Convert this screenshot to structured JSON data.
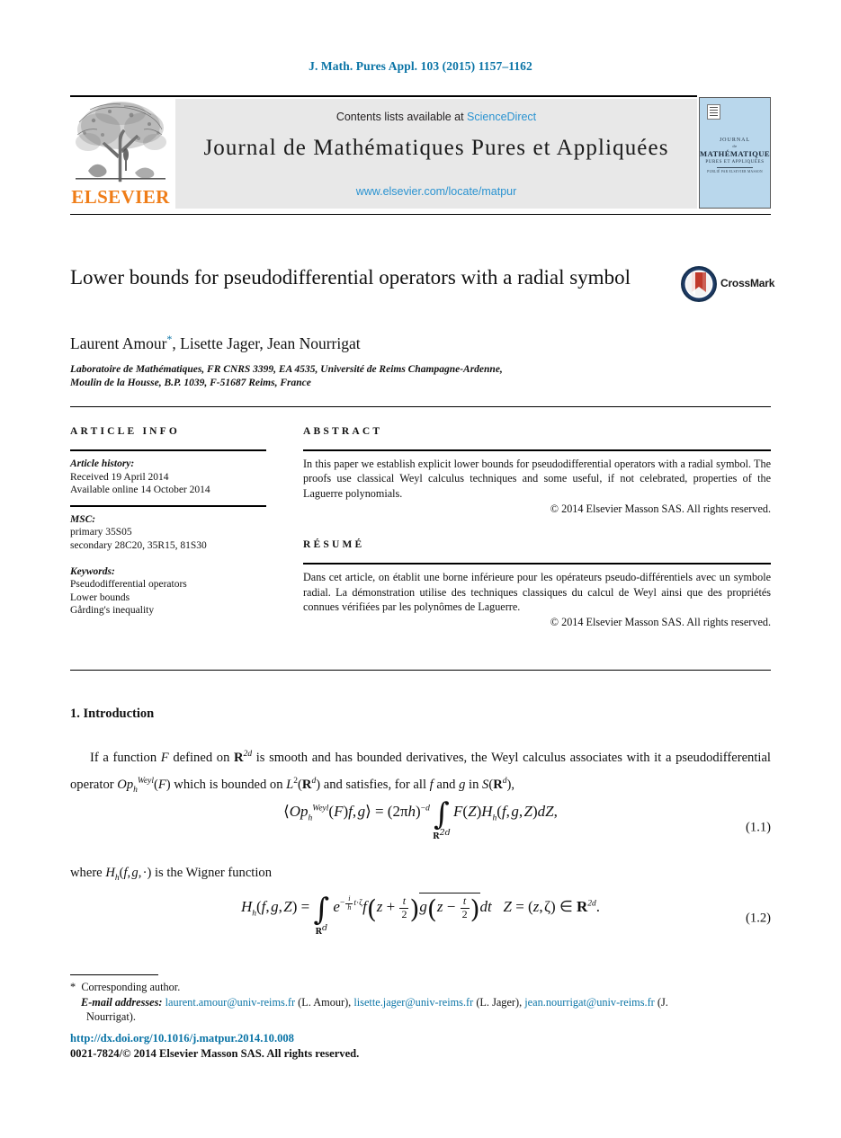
{
  "running_head": "J. Math. Pures Appl. 103 (2015) 1157–1162",
  "masthead": {
    "contents_prefix": "Contents lists available at ",
    "sciencedirect": "ScienceDirect",
    "journal_title": "Journal de Mathématiques Pures et Appliquées",
    "journal_url": "www.elsevier.com/locate/matpur",
    "publisher": "ELSEVIER",
    "cover": {
      "line1": "JOURNAL",
      "line2": "de",
      "line3": "MATHÉMATIQUES",
      "line4": "PURES ET APPLIQUÉES",
      "line5": "PUBLIÉ PAR ELSEVIER MASSON"
    }
  },
  "article": {
    "title": "Lower bounds for pseudodifferential operators with a radial symbol",
    "crossmark_label": "CrossMark",
    "authors": "Laurent Amour, Lisette Jager, Jean Nourrigat",
    "author_star": "*",
    "affiliation_line1": "Laboratoire de Mathématiques, FR CNRS 3399, EA 4535, Université de Reims Champagne-Ardenne,",
    "affiliation_line2": "Moulin de la Housse, B.P. 1039, F-51687 Reims, France"
  },
  "info": {
    "heading": "ARTICLE INFO",
    "history_label": "Article history:",
    "received": "Received 19 April 2014",
    "available": "Available online 14 October 2014",
    "msc_label": "MSC:",
    "msc_primary": "primary 35S05",
    "msc_secondary": "secondary 28C20, 35R15, 81S30",
    "keywords_label": "Keywords:",
    "keyword1": "Pseudodifferential operators",
    "keyword2": "Lower bounds",
    "keyword3": "Gårding's inequality"
  },
  "abstract": {
    "heading": "ABSTRACT",
    "text": "In this paper we establish explicit lower bounds for pseudodifferential operators with a radial symbol. The proofs use classical Weyl calculus techniques and some useful, if not celebrated, properties of the Laguerre polynomials.",
    "copyright": "© 2014 Elsevier Masson SAS. All rights reserved."
  },
  "resume": {
    "heading": "RÉSUMÉ",
    "text": "Dans cet article, on établit une borne inférieure pour les opérateurs pseudo-différentiels avec un symbole radial. La démonstration utilise des techniques classiques du calcul de Weyl ainsi que des propriétés connues vérifiées par les polynômes de Laguerre.",
    "copyright": "© 2014 Elsevier Masson SAS. All rights reserved."
  },
  "body": {
    "section_heading": "1. Introduction",
    "paragraph1_part1": "If a function ",
    "paragraph1": "If a function F defined on R2d is smooth and has bounded derivatives, the Weyl calculus associates with it a pseudodifferential operator OphWeyl(F) which is bounded on L2(Rd) and satisfies, for all f and g in S(Rd),",
    "equation1_number": "(1.1)",
    "paragraph2": "where Hh(f, g, ·) is the Wigner function",
    "equation2_number": "(1.2)"
  },
  "footer": {
    "corresponding_star": "*",
    "corresponding_author": "Corresponding author.",
    "email_label": "E-mail addresses:",
    "email1": "laurent.amour@univ-reims.fr",
    "email1_name": "(L. Amour),",
    "email2": "lisette.jager@univ-reims.fr",
    "email2_name": "(L. Jager),",
    "email3": "jean.nourrigat@univ-reims.fr",
    "email3_name": "(J. Nourrigat).",
    "doi": "http://dx.doi.org/10.1016/j.matpur.2014.10.008",
    "issn_line": "0021-7824/© 2014 Elsevier Masson SAS. All rights reserved."
  },
  "colors": {
    "link": "#0a74a6",
    "sciencedirect": "#2a93d1",
    "elsevier_orange": "#ef7d18",
    "band_gray": "#e8e8e8",
    "cover_blue": "#b9d7ec"
  }
}
